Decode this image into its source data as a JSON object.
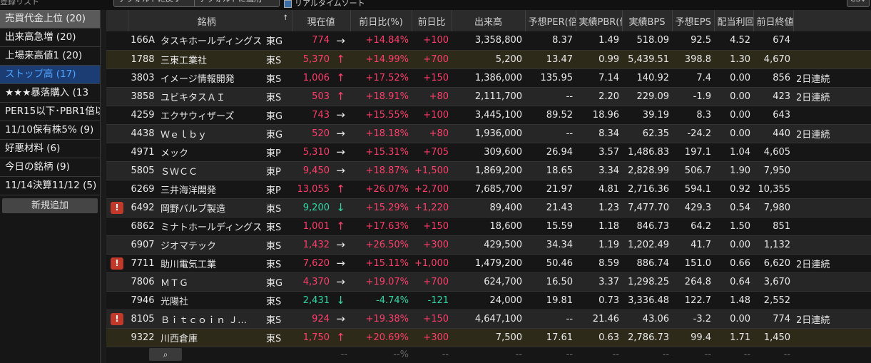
{
  "toolbar": {
    "list_label": "登録リスト",
    "default_back_label": "デフォルトに戻す",
    "default_apply_label": "デフォルトに適用",
    "realtime_label": "リアルタイムソート",
    "csv_label": "CSV"
  },
  "sidebar": {
    "items": [
      {
        "label": "売買代金上位 (20)"
      },
      {
        "label": "出来高急増 (20)"
      },
      {
        "label": "上場来高値1 (20)"
      },
      {
        "label": "ストップ高 (17)"
      },
      {
        "label": "★★★暴落購入 (13"
      },
      {
        "label": "PER15以下･PBR1倍以"
      },
      {
        "label": "11/10保有株5% (9)"
      },
      {
        "label": "好悪材料 (6)"
      },
      {
        "label": "今日の銘柄 (9)"
      },
      {
        "label": "11/14決算11/12 (5)"
      }
    ],
    "new_button": "新規追加"
  },
  "table": {
    "headers": [
      "",
      "銘柄",
      "現在値",
      "前日比(%)",
      "前日比",
      "出来高",
      "予想PER(倍",
      "実績PBR(倍",
      "実績BPS",
      "予想EPS",
      "配当利回",
      "前日終値",
      ""
    ],
    "sort_icon": "↑",
    "rows": [
      {
        "warn": false,
        "code": "166A",
        "name": "タスキホールディングス",
        "mkt": "東G",
        "price": "774",
        "arrow": "→",
        "dir": "flat",
        "pct": "+14.84%",
        "chg": "+100",
        "vol": "3,358,800",
        "per": "8.37",
        "pbr": "1.49",
        "bps": "518.09",
        "eps": "92.5",
        "yld": "4.52",
        "prev": "674",
        "note": ""
      },
      {
        "warn": false,
        "code": "1788",
        "name": "三東工業社",
        "mkt": "東S",
        "price": "5,370",
        "arrow": "↑",
        "dir": "up",
        "pct": "+14.99%",
        "chg": "+700",
        "vol": "5,200",
        "per": "13.47",
        "pbr": "0.99",
        "bps": "5,439.51",
        "eps": "398.8",
        "yld": "1.30",
        "prev": "4,670",
        "note": ""
      },
      {
        "warn": false,
        "code": "3803",
        "name": "イメージ情報開発",
        "mkt": "東S",
        "price": "1,006",
        "arrow": "↑",
        "dir": "up",
        "pct": "+17.52%",
        "chg": "+150",
        "vol": "1,386,000",
        "per": "135.95",
        "pbr": "7.14",
        "bps": "140.92",
        "eps": "7.4",
        "yld": "0.00",
        "prev": "856",
        "note": "2日連続"
      },
      {
        "warn": false,
        "code": "3858",
        "name": "ユビキタスＡＩ",
        "mkt": "東S",
        "price": "503",
        "arrow": "↑",
        "dir": "up",
        "pct": "+18.91%",
        "chg": "+80",
        "vol": "2,111,700",
        "per": "--",
        "pbr": "2.20",
        "bps": "229.09",
        "eps": "-1.9",
        "yld": "0.00",
        "prev": "423",
        "note": "2日連続"
      },
      {
        "warn": false,
        "code": "4259",
        "name": "エクサウィザーズ",
        "mkt": "東G",
        "price": "743",
        "arrow": "→",
        "dir": "flat",
        "pct": "+15.55%",
        "chg": "+100",
        "vol": "3,445,100",
        "per": "89.52",
        "pbr": "18.96",
        "bps": "39.19",
        "eps": "8.3",
        "yld": "0.00",
        "prev": "643",
        "note": ""
      },
      {
        "warn": false,
        "code": "4438",
        "name": "Ｗｅｌｂｙ",
        "mkt": "東G",
        "price": "520",
        "arrow": "→",
        "dir": "flat",
        "pct": "+18.18%",
        "chg": "+80",
        "vol": "1,936,000",
        "per": "--",
        "pbr": "8.34",
        "bps": "62.35",
        "eps": "-24.2",
        "yld": "0.00",
        "prev": "440",
        "note": "2日連続"
      },
      {
        "warn": false,
        "code": "4971",
        "name": "メック",
        "mkt": "東P",
        "price": "5,310",
        "arrow": "→",
        "dir": "flat",
        "pct": "+15.31%",
        "chg": "+705",
        "vol": "309,600",
        "per": "26.94",
        "pbr": "3.57",
        "bps": "1,486.83",
        "eps": "197.1",
        "yld": "1.04",
        "prev": "4,605",
        "note": ""
      },
      {
        "warn": false,
        "code": "5805",
        "name": "ＳＷＣＣ",
        "mkt": "東P",
        "price": "9,450",
        "arrow": "→",
        "dir": "flat",
        "pct": "+18.87%",
        "chg": "+1,500",
        "vol": "1,869,200",
        "per": "18.65",
        "pbr": "3.34",
        "bps": "2,828.99",
        "eps": "506.7",
        "yld": "1.90",
        "prev": "7,950",
        "note": ""
      },
      {
        "warn": false,
        "code": "6269",
        "name": "三井海洋開発",
        "mkt": "東P",
        "price": "13,055",
        "arrow": "↑",
        "dir": "up",
        "pct": "+26.07%",
        "chg": "+2,700",
        "vol": "7,685,700",
        "per": "21.97",
        "pbr": "4.81",
        "bps": "2,716.36",
        "eps": "594.1",
        "yld": "0.92",
        "prev": "10,355",
        "note": ""
      },
      {
        "warn": true,
        "code": "6492",
        "name": "岡野バルブ製造",
        "mkt": "東S",
        "price": "9,200",
        "arrow": "↓",
        "dir": "down",
        "pct": "+15.29%",
        "chg": "+1,220",
        "vol": "89,400",
        "per": "21.43",
        "pbr": "1.23",
        "bps": "7,477.70",
        "eps": "429.3",
        "yld": "0.54",
        "prev": "7,980",
        "note": ""
      },
      {
        "warn": false,
        "code": "6862",
        "name": "ミナトホールディングス",
        "mkt": "東S",
        "price": "1,001",
        "arrow": "↑",
        "dir": "up",
        "pct": "+17.63%",
        "chg": "+150",
        "vol": "18,600",
        "per": "15.59",
        "pbr": "1.18",
        "bps": "846.73",
        "eps": "64.2",
        "yld": "1.50",
        "prev": "851",
        "note": ""
      },
      {
        "warn": false,
        "code": "6907",
        "name": "ジオマテック",
        "mkt": "東S",
        "price": "1,432",
        "arrow": "→",
        "dir": "flat",
        "pct": "+26.50%",
        "chg": "+300",
        "vol": "429,500",
        "per": "34.34",
        "pbr": "1.19",
        "bps": "1,202.49",
        "eps": "41.7",
        "yld": "0.00",
        "prev": "1,132",
        "note": ""
      },
      {
        "warn": true,
        "code": "7711",
        "name": "助川電気工業",
        "mkt": "東S",
        "price": "7,620",
        "arrow": "→",
        "dir": "flat",
        "pct": "+15.11%",
        "chg": "+1,000",
        "vol": "1,479,200",
        "per": "50.46",
        "pbr": "8.59",
        "bps": "886.74",
        "eps": "151.0",
        "yld": "0.66",
        "prev": "6,620",
        "note": "2日連続"
      },
      {
        "warn": false,
        "code": "7806",
        "name": "ＭＴＧ",
        "mkt": "東G",
        "price": "4,370",
        "arrow": "→",
        "dir": "flat",
        "pct": "+19.07%",
        "chg": "+700",
        "vol": "624,700",
        "per": "16.50",
        "pbr": "3.37",
        "bps": "1,298.25",
        "eps": "264.8",
        "yld": "0.64",
        "prev": "3,670",
        "note": ""
      },
      {
        "warn": false,
        "code": "7946",
        "name": "光陽社",
        "mkt": "東S",
        "price": "2,431",
        "arrow": "↓",
        "dir": "down",
        "pct": "-4.74%",
        "chg": "-121",
        "vol": "24,000",
        "per": "19.81",
        "pbr": "0.73",
        "bps": "3,336.48",
        "eps": "122.7",
        "yld": "1.48",
        "prev": "2,552",
        "note": "",
        "neg": true
      },
      {
        "warn": true,
        "code": "8105",
        "name": "Ｂｉｔｃｏｉｎ Ｊ…",
        "mkt": "東S",
        "price": "924",
        "arrow": "→",
        "dir": "flat",
        "pct": "+19.38%",
        "chg": "+150",
        "vol": "4,647,100",
        "per": "--",
        "pbr": "21.46",
        "bps": "43.06",
        "eps": "-3.2",
        "yld": "0.00",
        "prev": "774",
        "note": "2日連続"
      },
      {
        "warn": false,
        "code": "9322",
        "name": "川西倉庫",
        "mkt": "東S",
        "price": "1,750",
        "arrow": "↑",
        "dir": "up",
        "pct": "+20.69%",
        "chg": "+300",
        "vol": "7,500",
        "per": "17.61",
        "pbr": "0.63",
        "bps": "2,786.73",
        "eps": "99.4",
        "yld": "1.71",
        "prev": "1,450",
        "note": ""
      }
    ],
    "footer": {
      "search_icon": "search-icon",
      "dash": "--",
      "pct_dash": "--%"
    }
  },
  "colors": {
    "up": "#ff3d6a",
    "down": "#2fd6a3",
    "selected_sidebar": "#1c3c74"
  }
}
